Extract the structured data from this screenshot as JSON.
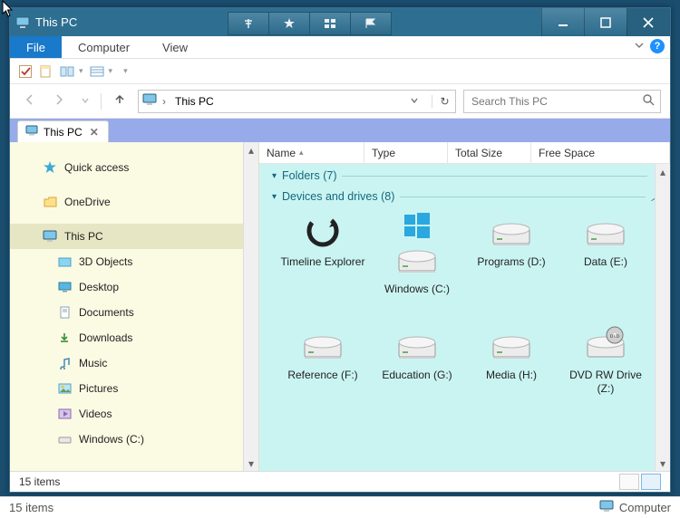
{
  "title": "This PC",
  "ribbon": {
    "file": "File",
    "tabs": [
      "Computer",
      "View"
    ]
  },
  "address": {
    "location": "This PC"
  },
  "search": {
    "placeholder": "Search This PC"
  },
  "doctab": {
    "label": "This PC"
  },
  "nav": {
    "quick": "Quick access",
    "onedrive": "OneDrive",
    "thispc": "This PC",
    "children": [
      "3D Objects",
      "Desktop",
      "Documents",
      "Downloads",
      "Music",
      "Pictures",
      "Videos",
      "Windows (C:)"
    ]
  },
  "columns": [
    "Name",
    "Type",
    "Total Size",
    "Free Space"
  ],
  "group_folders": {
    "label": "Folders",
    "count": 7
  },
  "group_devices": {
    "label": "Devices and drives",
    "count": 8
  },
  "devices": [
    {
      "name": "Timeline Explorer",
      "kind": "app"
    },
    {
      "name": "Windows (C:)",
      "kind": "drive"
    },
    {
      "name": "Programs (D:)",
      "kind": "drive"
    },
    {
      "name": "Data (E:)",
      "kind": "drive"
    },
    {
      "name": "Reference (F:)",
      "kind": "drive"
    },
    {
      "name": "Education (G:)",
      "kind": "drive"
    },
    {
      "name": "Media (H:)",
      "kind": "drive"
    },
    {
      "name": "DVD RW Drive (Z:)",
      "kind": "dvd"
    }
  ],
  "status": {
    "left": "15 items",
    "outer_left": "15 items",
    "outer_right": "Computer"
  }
}
